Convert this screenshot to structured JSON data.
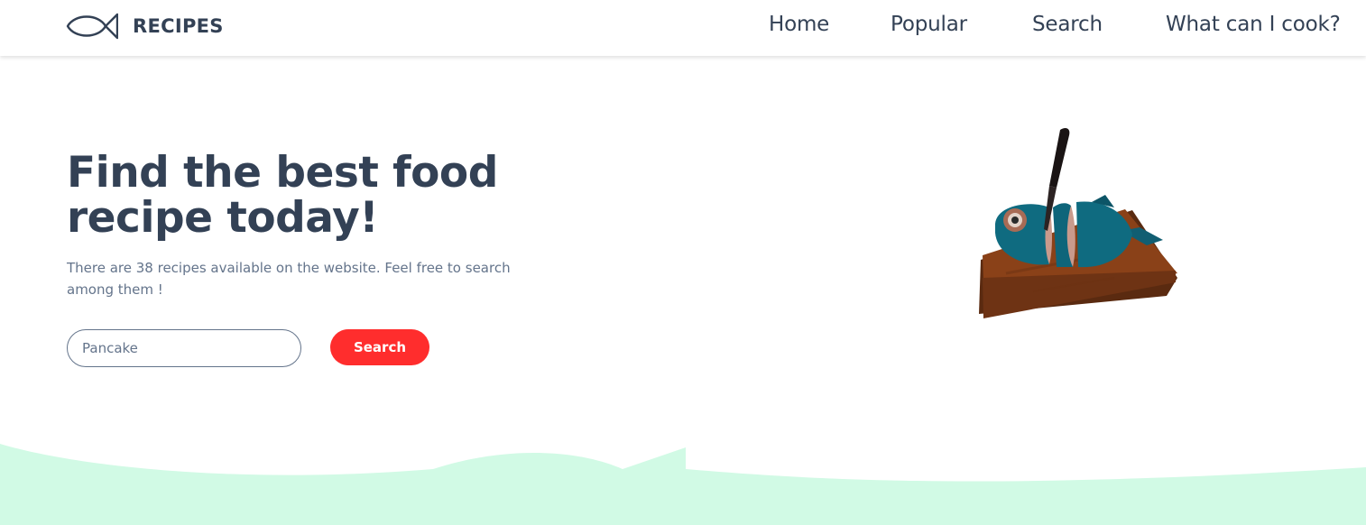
{
  "header": {
    "brand": "RECIPES",
    "logo_icon": "fish-icon",
    "nav": [
      {
        "label": "Home"
      },
      {
        "label": "Popular"
      },
      {
        "label": "Search"
      },
      {
        "label": "What can I cook?"
      }
    ]
  },
  "hero": {
    "title": "Find the best food recipe today!",
    "description": "There are 38 recipes available on the website. Feel free to search among them !",
    "search": {
      "placeholder": "Pancake",
      "value": "",
      "button_label": "Search"
    },
    "illustration": "fish-on-cutting-board-illustration"
  },
  "colors": {
    "text": "#334155",
    "muted": "#64748b",
    "accent": "#ff2d2d",
    "wave": "#d1fae5"
  }
}
